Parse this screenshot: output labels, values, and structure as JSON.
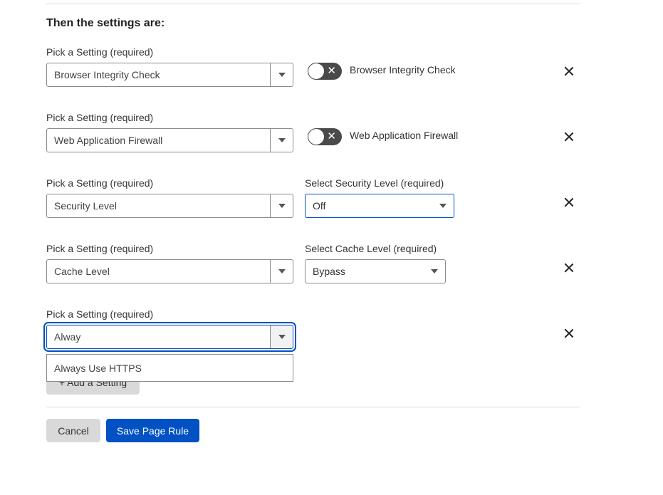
{
  "section_title": "Then the settings are:",
  "settings": [
    {
      "pick_label": "Pick a Setting (required)",
      "value": "Browser Integrity Check",
      "control": "toggle",
      "toggle_label": "Browser Integrity Check",
      "toggle_on": false
    },
    {
      "pick_label": "Pick a Setting (required)",
      "value": "Web Application Firewall",
      "control": "toggle",
      "toggle_label": "Web Application Firewall",
      "toggle_on": false
    },
    {
      "pick_label": "Pick a Setting (required)",
      "value": "Security Level",
      "control": "select",
      "select_label": "Select Security Level (required)",
      "select_value": "Off"
    },
    {
      "pick_label": "Pick a Setting (required)",
      "value": "Cache Level",
      "control": "select",
      "select_label": "Select Cache Level (required)",
      "select_value": "Bypass"
    },
    {
      "pick_label": "Pick a Setting (required)",
      "value": "Alway",
      "control": "none"
    }
  ],
  "dropdown_options": [
    "Always Use HTTPS"
  ],
  "add_setting_label": "+ Add a Setting",
  "icons": {
    "toggle_off": "x-icon",
    "remove": "close-icon",
    "dropdown": "caret-down-icon"
  },
  "buttons": {
    "cancel": "Cancel",
    "save": "Save Page Rule"
  },
  "colors": {
    "primary": "#0051c3",
    "toggle_off": "#4a4a4a",
    "secondary_button": "#d9d9d9"
  }
}
